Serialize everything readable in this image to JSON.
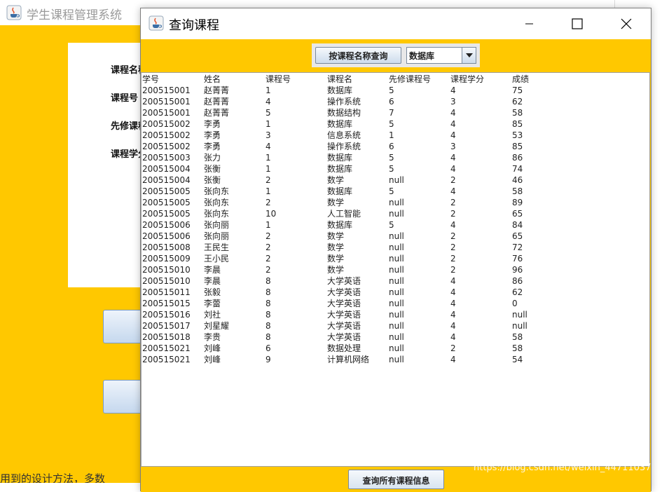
{
  "background_window": {
    "title": "学生课程管理系统",
    "labels": [
      "课程名称",
      "课程号",
      "先修课程号",
      "课程学分"
    ],
    "bottom_text": "用到的设计方法，多数"
  },
  "dialog": {
    "title": "查询课程",
    "query_by_name_button": "按课程名称查询",
    "course_select_value": "数据库",
    "query_all_button": "查询所有课程信息"
  },
  "table": {
    "columns": [
      "学号",
      "姓名",
      "课程号",
      "课程名",
      "先修课程号",
      "课程学分",
      "成绩"
    ],
    "rows": [
      [
        "200515001",
        "赵菁菁",
        "1",
        "数据库",
        "5",
        "4",
        "75"
      ],
      [
        "200515001",
        "赵菁菁",
        "4",
        "操作系统",
        "6",
        "3",
        "62"
      ],
      [
        "200515001",
        "赵菁菁",
        "5",
        "数据结构",
        "7",
        "4",
        "58"
      ],
      [
        "200515002",
        "李勇",
        "1",
        "数据库",
        "5",
        "4",
        "85"
      ],
      [
        "200515002",
        "李勇",
        "3",
        "信息系统",
        "1",
        "4",
        "53"
      ],
      [
        "200515002",
        "李勇",
        "4",
        "操作系统",
        "6",
        "3",
        "85"
      ],
      [
        "200515003",
        "张力",
        "1",
        "数据库",
        "5",
        "4",
        "86"
      ],
      [
        "200515004",
        "张衡",
        "1",
        "数据库",
        "5",
        "4",
        "74"
      ],
      [
        "200515004",
        "张衡",
        "2",
        "数学",
        "null",
        "2",
        "46"
      ],
      [
        "200515005",
        "张向东",
        "1",
        "数据库",
        "5",
        "4",
        "58"
      ],
      [
        "200515005",
        "张向东",
        "2",
        "数学",
        "null",
        "2",
        "89"
      ],
      [
        "200515005",
        "张向东",
        "10",
        "人工智能",
        "null",
        "2",
        "65"
      ],
      [
        "200515006",
        "张向丽",
        "1",
        "数据库",
        "5",
        "4",
        "84"
      ],
      [
        "200515006",
        "张向丽",
        "2",
        "数学",
        "null",
        "2",
        "65"
      ],
      [
        "200515008",
        "王民生",
        "2",
        "数学",
        "null",
        "2",
        "72"
      ],
      [
        "200515009",
        "王小民",
        "2",
        "数学",
        "null",
        "2",
        "76"
      ],
      [
        "200515010",
        "李晨",
        "2",
        "数学",
        "null",
        "2",
        "96"
      ],
      [
        "200515010",
        "李晨",
        "8",
        "大学英语",
        "null",
        "4",
        "86"
      ],
      [
        "200515011",
        "张毅",
        "8",
        "大学英语",
        "null",
        "4",
        "62"
      ],
      [
        "200515015",
        "李蕾",
        "8",
        "大学英语",
        "null",
        "4",
        "0"
      ],
      [
        "200515016",
        "刘社",
        "8",
        "大学英语",
        "null",
        "4",
        "null"
      ],
      [
        "200515017",
        "刘星耀",
        "8",
        "大学英语",
        "null",
        "4",
        "null"
      ],
      [
        "200515018",
        "李贵",
        "8",
        "大学英语",
        "null",
        "4",
        "58"
      ],
      [
        "200515021",
        "刘峰",
        "6",
        "数据处理",
        "null",
        "2",
        "58"
      ],
      [
        "200515021",
        "刘峰",
        "9",
        "计算机网络",
        "null",
        "4",
        "54"
      ]
    ]
  },
  "watermark": "https://blog.csdn.net/weixin_44711037",
  "icons": [
    "java-icon",
    "minimize-icon",
    "maximize-icon",
    "close-icon",
    "dropdown-arrow-icon"
  ],
  "colors": {
    "accent": "#ffc800"
  }
}
